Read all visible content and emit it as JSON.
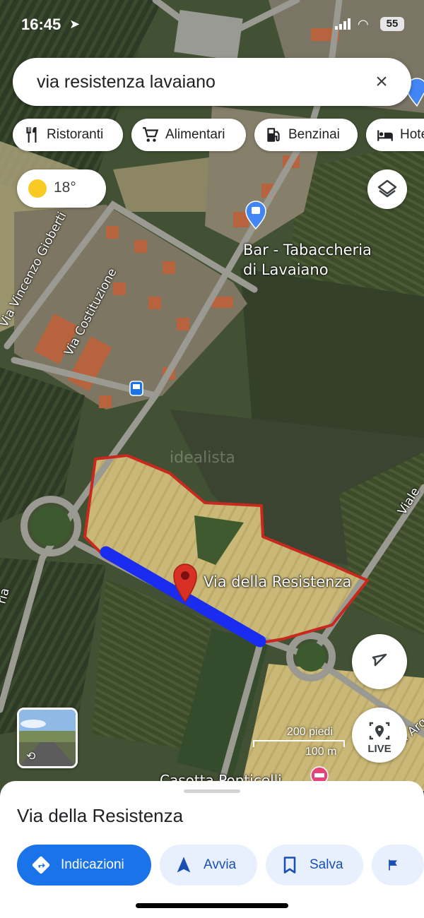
{
  "status_bar": {
    "time": "16:45",
    "battery": "55"
  },
  "search": {
    "query": "via resistenza lavaiano",
    "close_label": "×"
  },
  "chips": [
    {
      "label": "Ristoranti",
      "icon": "fork-knife-icon"
    },
    {
      "label": "Alimentari",
      "icon": "cart-icon"
    },
    {
      "label": "Benzinai",
      "icon": "gas-pump-icon"
    },
    {
      "label": "Hote",
      "icon": "bed-icon"
    }
  ],
  "weather": {
    "temp": "18°",
    "icon": "sun-icon"
  },
  "map": {
    "place_labels": {
      "bar_line1": "Bar - Tabaccheria",
      "bar_line2": "di Lavaiano",
      "pin_label": "Via della Resistenza",
      "bottom_poi": "Casotta Ponticelli",
      "watermark": "idealista"
    },
    "street_labels": {
      "gioberti": "Via Vincenzo Gioberti",
      "costituzione": "Via Costituzione",
      "viale": "Viale",
      "via_arg": "Via Arg",
      "left_fragment": "ria"
    },
    "scale": {
      "feet": "200 piedi",
      "meters": "100 m"
    },
    "live_label": "LIVE",
    "colors": {
      "highlight_route": "#1a2cf0",
      "parcel_outline": "#c8281e",
      "pin": "#d93025"
    }
  },
  "sheet": {
    "title": "Via della Resistenza",
    "actions": [
      {
        "label": "Indicazioni",
        "icon": "directions-icon",
        "primary": true
      },
      {
        "label": "Avvia",
        "icon": "navigation-arrow-icon"
      },
      {
        "label": "Salva",
        "icon": "bookmark-icon"
      },
      {
        "label": "",
        "icon": "flag-icon"
      }
    ]
  }
}
